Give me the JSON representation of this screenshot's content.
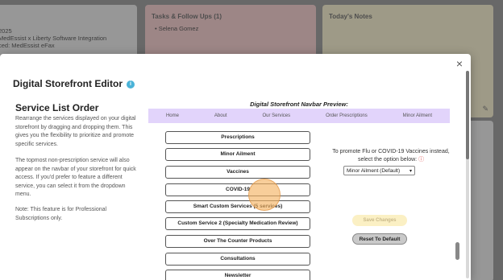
{
  "background": {
    "card1": {
      "lines": [
        "2025",
        "MedEssist x Liberty Software Integration",
        "ced: MedEssist eFax"
      ]
    },
    "card2": {
      "title": "Tasks & Follow Ups (1)",
      "item": "• Selena Gomez"
    },
    "card3": {
      "title": "Today's Notes"
    }
  },
  "modal": {
    "title": "Digital Storefront Editor",
    "info_icon": "i",
    "close_icon": "×",
    "section_title": "Service List Order",
    "desc1": "Rearrange the services displayed on your digital storefront by dragging and dropping them. This gives you the flexibility to prioritize and promote specific services.",
    "desc2": "The topmost non-prescription service will also appear on the navbar of your storefront for quick access. If you'd prefer to feature a different service, you can select it from the dropdown menu.",
    "desc3": "Note: This feature is for Professional Subscriptions only.",
    "preview_label": "Digital Storefront Navbar Preview:",
    "navbar": [
      "Home",
      "About",
      "Our Services",
      "Order Prescriptions",
      "Minor Ailment"
    ],
    "services": [
      "Prescriptions",
      "Minor Ailment",
      "Vaccines",
      "COVID-19",
      "Smart Custom Services (5 services)",
      "Custom Service 2 (Specialty Medication Review)",
      "Over The Counter Products",
      "Consultations",
      "Newsletter"
    ],
    "promo_text": "To promote Flu or COVID-19 Vaccines instead, select the option below:",
    "warn_icon": "ⓘ",
    "select_value": "Minor Ailment (Default)",
    "save_label": "Save Changes",
    "reset_label": "Reset To Default"
  }
}
